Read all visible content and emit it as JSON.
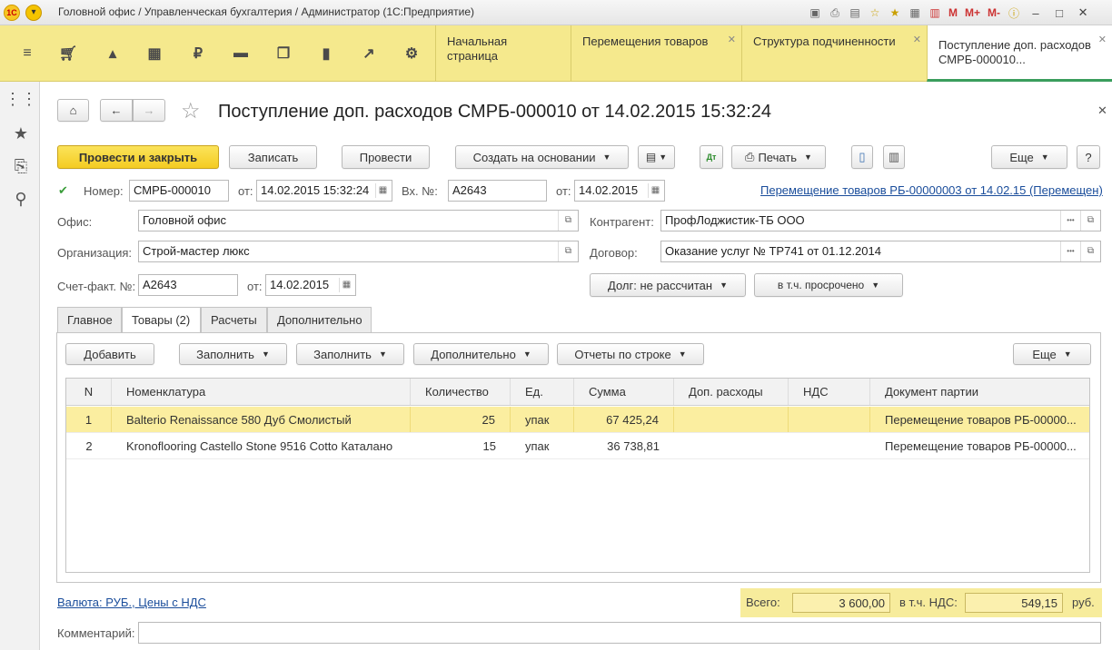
{
  "titlebar": {
    "logo": "1С",
    "title": "Головной офис / Управленческая бухгалтерия / Администратор  (1С:Предприятие)",
    "m_buttons": [
      "M",
      "M+",
      "M-"
    ]
  },
  "sections": {
    "icons": [
      "menu-icon",
      "cart-icon",
      "bag-icon",
      "warehouse-icon",
      "ruble-icon",
      "truck-icon",
      "documents-icon",
      "chart-icon",
      "trend-icon",
      "gear-icon"
    ]
  },
  "tabs": [
    {
      "label": "Начальная страница"
    },
    {
      "label": "Перемещения товаров"
    },
    {
      "label": "Структура подчиненности"
    },
    {
      "label": "Поступление доп. расходов СМРБ-000010..."
    }
  ],
  "doc": {
    "title": "Поступление доп. расходов СМРБ-000010 от 14.02.2015 15:32:24"
  },
  "toolbar": {
    "post_close": "Провести и закрыть",
    "save": "Записать",
    "post": "Провести",
    "create_based": "Создать на основании",
    "print": "Печать",
    "more": "Еще",
    "help": "?"
  },
  "header": {
    "number_label": "Номер:",
    "number": "СМРБ-000010",
    "from_label": "от:",
    "date": "14.02.2015 15:32:24",
    "inc_label": "Вх. №:",
    "inc_number": "A2643",
    "inc_date": "14.02.2015",
    "related_link": "Перемещение товаров РБ-00000003 от 14.02.15 (Перемещен)",
    "office_label": "Офис:",
    "office": "Головной офис",
    "org_label": "Организация:",
    "org": "Строй-мастер люкс",
    "counterparty_label": "Контрагент:",
    "counterparty": "ПрофЛоджистик-ТБ ООО",
    "contract_label": "Договор:",
    "contract": "Оказание услуг № ТР741 от 01.12.2014",
    "invoice_label": "Счет-факт. №:",
    "invoice": "А2643",
    "invoice_date_label": "от:",
    "invoice_date": "14.02.2015",
    "debt": "Долг: не рассчитан",
    "overdue": "в т.ч. просрочено"
  },
  "form_tabs": [
    "Главное",
    "Товары (2)",
    "Расчеты",
    "Дополнительно"
  ],
  "grid_toolbar": {
    "add": "Добавить",
    "fill1": "Заполнить",
    "fill2": "Заполнить",
    "extra": "Дополнительно",
    "reports": "Отчеты по строке",
    "more": "Еще"
  },
  "grid": {
    "columns": [
      "N",
      "Номенклатура",
      "Количество",
      "Ед.",
      "Сумма",
      "Доп. расходы",
      "НДС",
      "Документ партии"
    ],
    "rows": [
      {
        "n": "1",
        "item": "Balterio Renaissance 580 Дуб Смолистый",
        "qty": "25",
        "unit": "упак",
        "sum": "67 425,24",
        "extra": "",
        "vat": "",
        "batch": "Перемещение товаров РБ-00000..."
      },
      {
        "n": "2",
        "item": "Kronoflooring Castello Stone 9516 Cotto Каталано",
        "qty": "15",
        "unit": "упак",
        "sum": "36 738,81",
        "extra": "",
        "vat": "",
        "batch": "Перемещение товаров РБ-00000..."
      }
    ]
  },
  "footer": {
    "currency_link": "Валюта: РУБ., Цены с НДС",
    "total_label": "Всего:",
    "total": "3 600,00",
    "vat_label": "в т.ч. НДС:",
    "vat": "549,15",
    "currency": "руб.",
    "comment_label": "Комментарий:",
    "comment": ""
  },
  "colors": {
    "accent_yellow": "#f4cc22",
    "section_bar": "#f5e98d",
    "selected_row": "#fbeea0",
    "link": "#1a4d9b",
    "active_tab_underline": "#3a9d5d"
  }
}
